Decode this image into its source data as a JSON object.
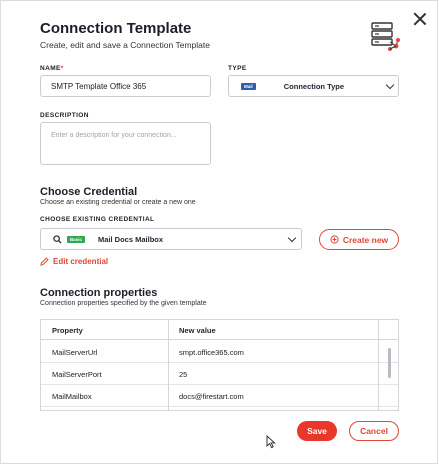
{
  "dialog": {
    "title": "Connection Template",
    "subtitle": "Create, edit and save a Connection Template"
  },
  "form": {
    "name_label": "NAME",
    "name_required_mark": "*",
    "name_value": "SMTP Template Office 365",
    "type_label": "TYPE",
    "type_badge": "Mail",
    "type_value": "Connection Type",
    "description_label": "DESCRIPTION",
    "description_placeholder": "Enter a description for your connection..."
  },
  "credential": {
    "section_title": "Choose Credential",
    "section_subtitle": "Choose an existing credential or create a new one",
    "existing_label": "CHOOSE EXISTING CREDENTIAL",
    "badge": "Basic",
    "selected": "Mail Docs Mailbox",
    "create_new_label": "Create new",
    "edit_label": "Edit credential"
  },
  "properties": {
    "section_title": "Connection properties",
    "section_subtitle": "Connection properties specified by the given template",
    "columns": [
      "Property",
      "New value"
    ],
    "rows": [
      {
        "property": "MailServerUrl",
        "value": "smpt.office365.com"
      },
      {
        "property": "MailServerPort",
        "value": "25"
      },
      {
        "property": "MailMailbox",
        "value": "docs@firestart.com"
      }
    ]
  },
  "actions": {
    "save_label": "Save",
    "cancel_label": "Cancel"
  },
  "colors": {
    "accent": "#e8382c",
    "mail_badge": "#2f5ea8",
    "basic_badge": "#2fa84f"
  },
  "icons": {
    "header": "server-network-icon",
    "close": "close-icon",
    "search": "search-icon",
    "edit": "pencil-icon",
    "add": "plus-circle-icon"
  }
}
